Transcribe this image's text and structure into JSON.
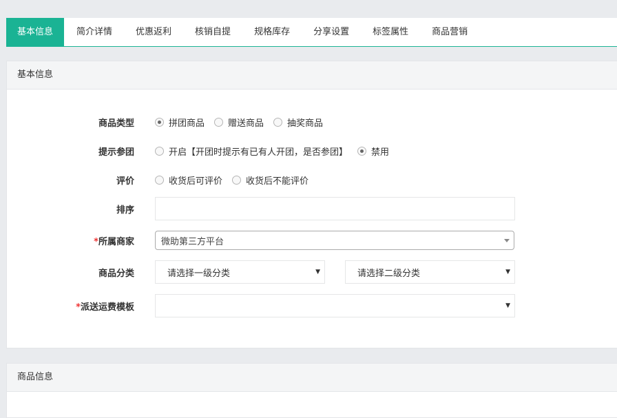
{
  "tabs": [
    {
      "label": "基本信息",
      "active": true
    },
    {
      "label": "简介详情"
    },
    {
      "label": "优惠返利"
    },
    {
      "label": "核销自提"
    },
    {
      "label": "规格库存"
    },
    {
      "label": "分享设置"
    },
    {
      "label": "标签属性"
    },
    {
      "label": "商品营销"
    }
  ],
  "basic": {
    "title": "基本信息",
    "goods_type": {
      "label": "商品类型",
      "options": [
        "拼团商品",
        "赠送商品",
        "抽奖商品"
      ],
      "selected": 0
    },
    "join_tip": {
      "label": "提示参团",
      "options": [
        "开启【开团时提示有已有人开团，是否参团】",
        "禁用"
      ],
      "selected": 1
    },
    "review": {
      "label": "评价",
      "options": [
        "收货后可评价",
        "收货后不能评价"
      ],
      "selected": null
    },
    "sort": {
      "label": "排序",
      "value": ""
    },
    "merchant": {
      "required_mark": "*",
      "label": "所属商家",
      "value": "微助第三方平台"
    },
    "category": {
      "label": "商品分类",
      "level1": "请选择一级分类",
      "level2": "请选择二级分类"
    },
    "shipping": {
      "required_mark": "*",
      "label": "派送运费模板",
      "value": ""
    }
  },
  "goods": {
    "title": "商品信息"
  },
  "colors": {
    "accent": "#1ab394",
    "required": "#e33333"
  },
  "icons": {
    "select_arrow": "▼"
  }
}
